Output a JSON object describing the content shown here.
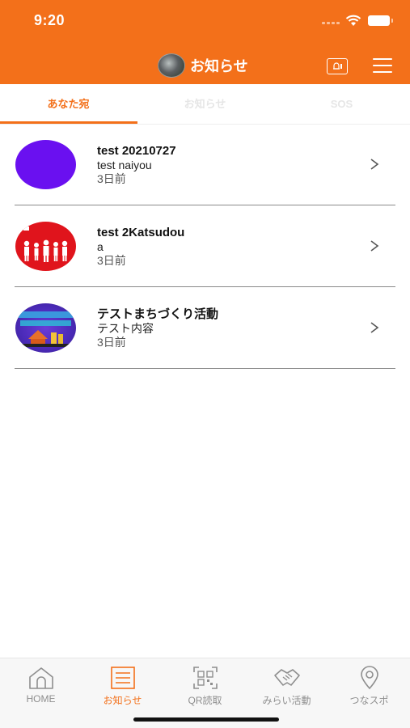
{
  "status_bar": {
    "time": "9:20"
  },
  "header": {
    "title": "お知らせ"
  },
  "tabs": [
    {
      "label": "あなた宛",
      "active": true
    },
    {
      "label": "お知らせ",
      "active": false
    },
    {
      "label": "SOS",
      "active": false
    }
  ],
  "notifications": [
    {
      "title": "test 20210727",
      "body": "test naiyou",
      "date": "3日前",
      "thumb": "purple"
    },
    {
      "title": "test 2Katsudou",
      "body": "a",
      "date": "3日前",
      "thumb": "red"
    },
    {
      "title": "テストまちづくり活動",
      "body": "テスト内容",
      "date": "3日前",
      "thumb": "blue"
    }
  ],
  "bottom_nav": [
    {
      "label": "HOME",
      "icon": "home-icon",
      "active": false
    },
    {
      "label": "お知らせ",
      "icon": "notice-icon",
      "active": true
    },
    {
      "label": "QR読取",
      "icon": "qr-icon",
      "active": false
    },
    {
      "label": "みらい活動",
      "icon": "handshake-icon",
      "active": false
    },
    {
      "label": "つなスポ",
      "icon": "location-pin-icon",
      "active": false
    }
  ],
  "colors": {
    "accent": "#f3701a",
    "inactive": "#8e8e8e",
    "divider": "#8a8a8a"
  }
}
